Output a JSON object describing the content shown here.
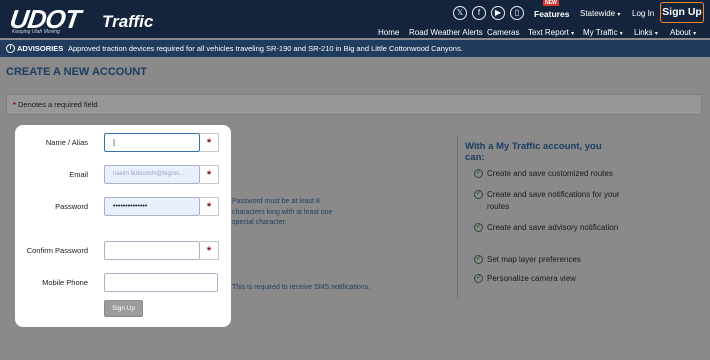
{
  "header": {
    "logo_text": "UDOT",
    "logo_tagline": "Keeping Utah Moving",
    "logo_product": "Traffic",
    "social_icons": [
      "x-icon",
      "facebook-icon",
      "youtube-icon",
      "mobile-app-icon"
    ],
    "features_label": "Features",
    "features_badge": "NEW",
    "statewide_label": "Statewide",
    "login_label": "Log In",
    "signup_label": "Sign Up",
    "nav": [
      "Home",
      "Road Weather Alerts",
      "Cameras",
      "Text Report",
      "My Traffic",
      "Links",
      "About"
    ]
  },
  "advisory": {
    "label": "ADVISORIES",
    "text": "Approved traction devices required for all vehicles traveling SR-190 and SR-210 in Big and Little Cottonwood Canyons."
  },
  "page": {
    "title": "CREATE A NEW ACCOUNT",
    "required_note": "Denotes a required field",
    "required_symbol": "*"
  },
  "form": {
    "name_label": "Name / Alias",
    "name_value": "",
    "email_label": "Email",
    "email_value": "nasim butounchi@bigros...",
    "password_label": "Password",
    "password_value": "••••••••••••••",
    "confirm_label": "Confirm Password",
    "confirm_value": "",
    "phone_label": "Mobile Phone",
    "phone_value": "",
    "submit_label": "Sign Up",
    "password_hint": "Password must be at least 8 characters long with at least one special character.",
    "phone_hint": "This is required to receive SMS notifications."
  },
  "benefits": {
    "title": "With a My Traffic account, you can:",
    "items": [
      "Create and save customized routes",
      "Create and save notifications for your routes",
      "Create and save advisory notification",
      "Set map layer preferences",
      "Personalize camera view"
    ]
  }
}
